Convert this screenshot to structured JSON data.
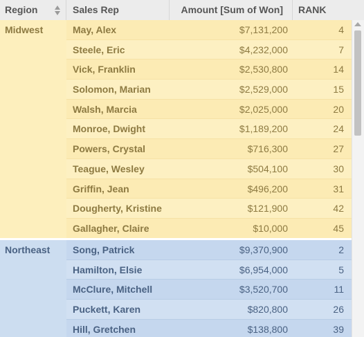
{
  "header": {
    "region": "Region",
    "sales_rep": "Sales Rep",
    "amount": "Amount [Sum of Won]",
    "rank": "RANK"
  },
  "groups": [
    {
      "region": "Midwest",
      "rows": [
        {
          "rep": "May, Alex",
          "amount": "$7,131,200",
          "rank": "4"
        },
        {
          "rep": "Steele, Eric",
          "amount": "$4,232,000",
          "rank": "7"
        },
        {
          "rep": "Vick, Franklin",
          "amount": "$2,530,800",
          "rank": "14"
        },
        {
          "rep": "Solomon, Marian",
          "amount": "$2,529,000",
          "rank": "15"
        },
        {
          "rep": "Walsh, Marcia",
          "amount": "$2,025,000",
          "rank": "20"
        },
        {
          "rep": "Monroe, Dwight",
          "amount": "$1,189,200",
          "rank": "24"
        },
        {
          "rep": "Powers, Crystal",
          "amount": "$716,300",
          "rank": "27"
        },
        {
          "rep": "Teague, Wesley",
          "amount": "$504,100",
          "rank": "30"
        },
        {
          "rep": "Griffin, Jean",
          "amount": "$496,200",
          "rank": "31"
        },
        {
          "rep": "Dougherty, Kristine",
          "amount": "$121,900",
          "rank": "42"
        },
        {
          "rep": "Gallagher, Claire",
          "amount": "$10,000",
          "rank": "45"
        }
      ]
    },
    {
      "region": "Northeast",
      "rows": [
        {
          "rep": "Song, Patrick",
          "amount": "$9,370,900",
          "rank": "2"
        },
        {
          "rep": "Hamilton, Elsie",
          "amount": "$6,954,000",
          "rank": "5"
        },
        {
          "rep": "McClure, Mitchell",
          "amount": "$3,520,700",
          "rank": "11"
        },
        {
          "rep": "Puckett, Karen",
          "amount": "$820,800",
          "rank": "26"
        },
        {
          "rep": "Hill, Gretchen",
          "amount": "$138,800",
          "rank": "39"
        }
      ]
    }
  ],
  "icons": {
    "sort": "sort-arrows-icon",
    "scroll_up": "scroll-up-arrow-icon"
  }
}
